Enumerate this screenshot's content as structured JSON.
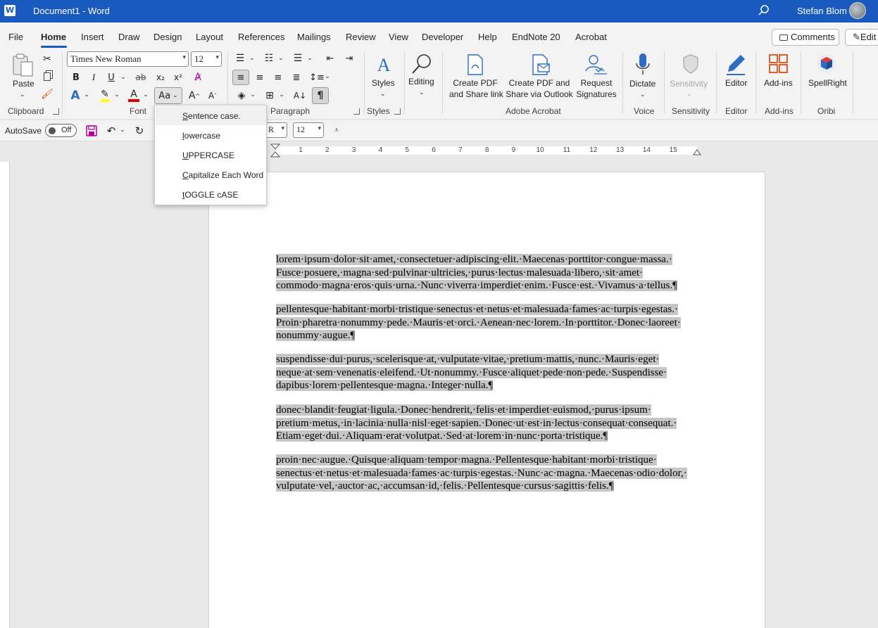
{
  "titlebar": {
    "document_title": "Document1  -  Word",
    "user_name": "Stefan Blom"
  },
  "menu_tabs": [
    {
      "label": "File"
    },
    {
      "label": "Home",
      "active": true
    },
    {
      "label": "Insert"
    },
    {
      "label": "Draw"
    },
    {
      "label": "Design"
    },
    {
      "label": "Layout"
    },
    {
      "label": "References"
    },
    {
      "label": "Mailings"
    },
    {
      "label": "Review"
    },
    {
      "label": "View"
    },
    {
      "label": "Developer"
    },
    {
      "label": "Help"
    },
    {
      "label": "EndNote 20"
    },
    {
      "label": "Acrobat"
    }
  ],
  "header_buttons": {
    "comments": "Comments",
    "edit": "Edit"
  },
  "ribbon": {
    "clipboard": {
      "paste": "Paste",
      "group": "Clipboard"
    },
    "font": {
      "font_name": "Times New Roman",
      "font_size": "12",
      "group": "Font",
      "bold": "B",
      "italic": "I",
      "underline": "U",
      "strikethrough": "ab",
      "subscript": "x₂",
      "superscript": "x²",
      "change_case": "Aa"
    },
    "paragraph": {
      "group": "Paragraph"
    },
    "styles": {
      "label": "Styles",
      "group": "Styles"
    },
    "editing": {
      "label": "Editing"
    },
    "acrobat": {
      "create_pdf_share_link": [
        "Create PDF",
        "and Share link"
      ],
      "create_pdf_outlook": [
        "Create PDF and",
        "Share via Outlook"
      ],
      "request_signatures": [
        "Request",
        "Signatures"
      ],
      "group": "Adobe Acrobat"
    },
    "voice": {
      "dictate": "Dictate",
      "group": "Voice"
    },
    "sensitivity": {
      "label": "Sensitivity",
      "group": "Sensitivity"
    },
    "editor": {
      "label": "Editor",
      "group": "Editor"
    },
    "addins": {
      "label": "Add-ins",
      "group": "Add-ins"
    },
    "oribi": {
      "label": "SpellRight",
      "group": "Oribi"
    }
  },
  "qat": {
    "autosave_label": "AutoSave",
    "autosave_state": "Off",
    "font_name_partial": "v R",
    "font_size": "12"
  },
  "ruler": {
    "numbers": [
      "1",
      "2",
      "3",
      "4",
      "5",
      "6",
      "7",
      "8",
      "9",
      "10",
      "11",
      "12",
      "13",
      "14",
      "15"
    ]
  },
  "change_case_menu": {
    "items": [
      {
        "label": "Sentence case.",
        "accel_char": "S",
        "rest": "entence case."
      },
      {
        "label": "lowercase",
        "accel_char": "l",
        "rest": "owercase"
      },
      {
        "label": "UPPERCASE",
        "accel_char": "U",
        "rest": "PPERCASE"
      },
      {
        "label": "Capitalize Each Word",
        "accel_char": "C",
        "rest": "apitalize Each Word"
      },
      {
        "label": "tOGGLE cASE",
        "accel_char": "t",
        "rest": "OGGLE cASE"
      }
    ]
  },
  "document": {
    "paragraphs": [
      [
        "lorem·ipsum·dolor·sit·amet,·consectetuer·adipiscing·elit.·Maecenas·porttitor·congue·massa.·",
        "Fusce·posuere,·magna·sed·pulvinar·ultricies,·purus·lectus·malesuada·libero,·sit·amet·",
        "commodo·magna·eros·quis·urna.·Nunc·viverra·imperdiet·enim.·Fusce·est.·Vivamus·a·tellus.¶"
      ],
      [
        "pellentesque·habitant·morbi·tristique·senectus·et·netus·et·malesuada·fames·ac·turpis·egestas.·",
        "Proin·pharetra·nonummy·pede.·Mauris·et·orci.·Aenean·nec·lorem.·In·porttitor.·Donec·laoreet·",
        "nonummy·augue.¶"
      ],
      [
        "suspendisse·dui·purus,·scelerisque·at,·vulputate·vitae,·pretium·mattis,·nunc.·Mauris·eget·",
        "neque·at·sem·venenatis·eleifend.·Ut·nonummy.·Fusce·aliquet·pede·non·pede.·Suspendisse·",
        "dapibus·lorem·pellentesque·magna.·Integer·nulla.¶"
      ],
      [
        "donec·blandit·feugiat·ligula.·Donec·hendrerit,·felis·et·imperdiet·euismod,·purus·ipsum·",
        "pretium·metus,·in·lacinia·nulla·nisl·eget·sapien.·Donec·ut·est·in·lectus·consequat·consequat.·",
        "Etiam·eget·dui.·Aliquam·erat·volutpat.·Sed·at·lorem·in·nunc·porta·tristique.¶"
      ],
      [
        "proin·nec·augue.·Quisque·aliquam·tempor·magna.·Pellentesque·habitant·morbi·tristique·",
        "senectus·et·netus·et·malesuada·fames·ac·turpis·egestas.·Nunc·ac·magna.·Maecenas·odio·dolor,·",
        "vulputate·vel,·auctor·ac,·accumsan·id,·felis.·Pellentesque·cursus·sagittis·felis.¶"
      ]
    ]
  }
}
